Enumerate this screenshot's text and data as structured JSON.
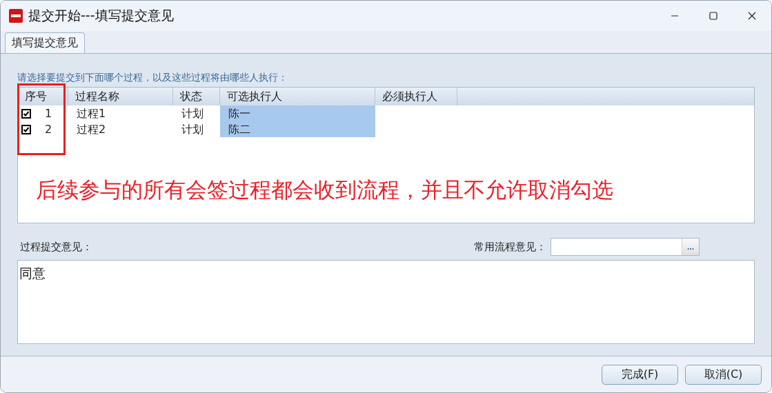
{
  "window": {
    "title": "提交开始---填写提交意见"
  },
  "tabs": [
    {
      "label": "填写提交意见",
      "selected": true
    }
  ],
  "hint": "请选择要提交到下面哪个过程，以及这些过程将由哪些人执行：",
  "table": {
    "columns": [
      "序号",
      "过程名称",
      "状态",
      "可选执行人",
      "必须执行人"
    ],
    "rows": [
      {
        "checked": true,
        "index": "1",
        "name": "过程1",
        "status": "计划",
        "optional": "陈一",
        "required_person": ""
      },
      {
        "checked": true,
        "index": "2",
        "name": "过程2",
        "status": "计划",
        "optional": "陈二",
        "required_person": ""
      }
    ]
  },
  "annotation": "后续参与的所有会签过程都会收到流程，并且不允许取消勾选",
  "comment_label": "过程提交意见：",
  "common_label": "常用流程意见：",
  "common_button": "...",
  "comment": "同意",
  "buttons": [
    "完成(F)",
    "取消(C)"
  ]
}
